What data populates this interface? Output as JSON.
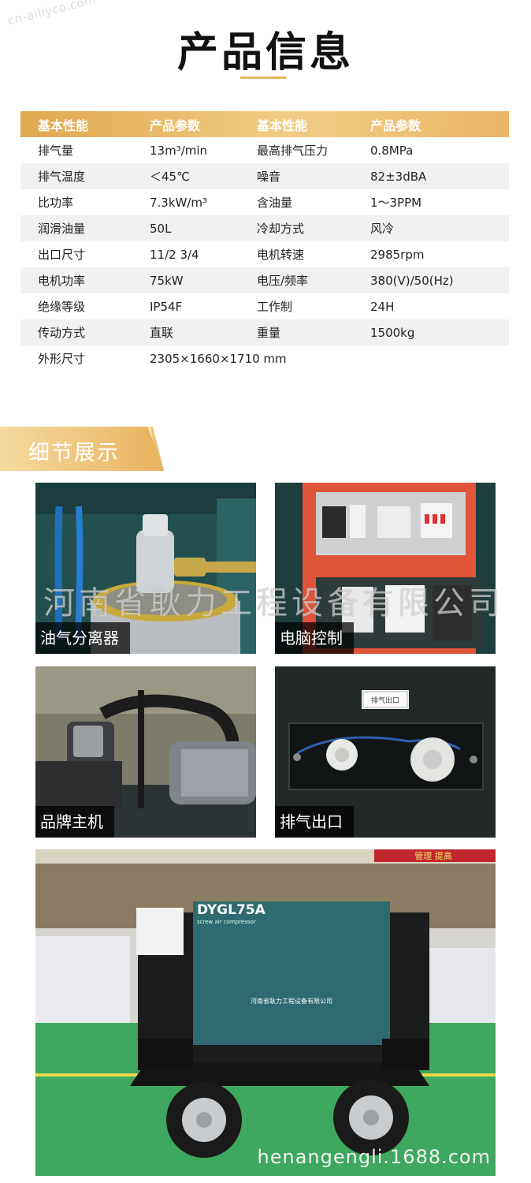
{
  "watermark_top": "cn-ailiyco.com",
  "page": {
    "title": "产品信息"
  },
  "spec_table": {
    "headers": [
      "基本性能",
      "产品参数",
      "基本性能",
      "产品参数"
    ],
    "rows": [
      [
        "排气量",
        "13m³/min",
        "最高排气压力",
        "0.8MPa"
      ],
      [
        "排气温度",
        "＜45℃",
        "噪音",
        "82±3dBA"
      ],
      [
        "比功率",
        "7.3kW/m³",
        "含油量",
        "1～3PPM"
      ],
      [
        "润滑油量",
        "50L",
        "冷却方式",
        "风冷"
      ],
      [
        "出口尺寸",
        "11/2  3/4",
        "电机转速",
        "2985rpm"
      ],
      [
        "电机功率",
        "75kW",
        "电压/频率",
        "380(V)/50(Hz)"
      ],
      [
        "绝缘等级",
        "IP54F",
        "工作制",
        "24H"
      ],
      [
        "传动方式",
        "直联",
        "重量",
        "1500kg"
      ],
      [
        "外形尺寸",
        "2305×1660×1710 mm",
        "",
        ""
      ]
    ]
  },
  "details": {
    "section_title": "细节展示",
    "photos": [
      {
        "caption": "油气分离器"
      },
      {
        "caption": "电脑控制"
      },
      {
        "caption": "品牌主机"
      },
      {
        "caption": "排气出口"
      }
    ],
    "machine": {
      "model": "DYGL75A",
      "model_sub": "screw air compressor",
      "company": "河南省耿力工程设备有限公司",
      "banner_text": "管理 提高"
    },
    "plate_text": "排气出口",
    "watermark_company": "河南省耿力工程设备有限公司",
    "watermark_site": "henangengli.1688.com"
  },
  "colors": {
    "gold": "#e3b35c",
    "machine_teal": "#2e6a70",
    "floor_green": "#3aa85a"
  }
}
